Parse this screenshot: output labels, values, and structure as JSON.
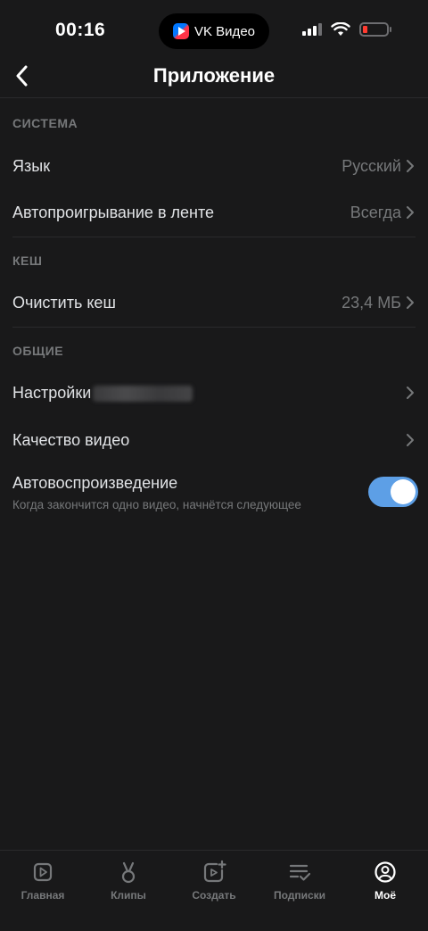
{
  "status_bar": {
    "time": "00:16",
    "island_app": "VK Видео",
    "battery_color": "#ff3b30"
  },
  "header": {
    "title": "Приложение",
    "back_icon": "chevron-left-icon"
  },
  "sections": {
    "system": {
      "title": "СИСТЕМА",
      "language_label": "Язык",
      "language_value": "Русский",
      "autoplay_feed_label": "Автопроигрывание в ленте",
      "autoplay_feed_value": "Всегда"
    },
    "cache": {
      "title": "КЕШ",
      "clear_label": "Очистить кеш",
      "clear_value": "23,4 МБ"
    },
    "general": {
      "title": "ОБЩИЕ",
      "settings_label": "Настройки",
      "video_quality_label": "Качество видео",
      "autoplay_label": "Автовоспроизведение",
      "autoplay_description": "Когда закончится одно видео, начнётся следующее",
      "autoplay_enabled": true
    }
  },
  "tabs": [
    {
      "label": "Главная",
      "icon": "play-square-icon",
      "active": false
    },
    {
      "label": "Клипы",
      "icon": "clips-icon",
      "active": false
    },
    {
      "label": "Создать",
      "icon": "add-video-icon",
      "active": false
    },
    {
      "label": "Подписки",
      "icon": "subscriptions-icon",
      "active": false
    },
    {
      "label": "Моё",
      "icon": "profile-icon",
      "active": true
    }
  ],
  "colors": {
    "background": "#19191a",
    "accent_toggle": "#5d9fe6",
    "secondary_text": "#76787a"
  }
}
